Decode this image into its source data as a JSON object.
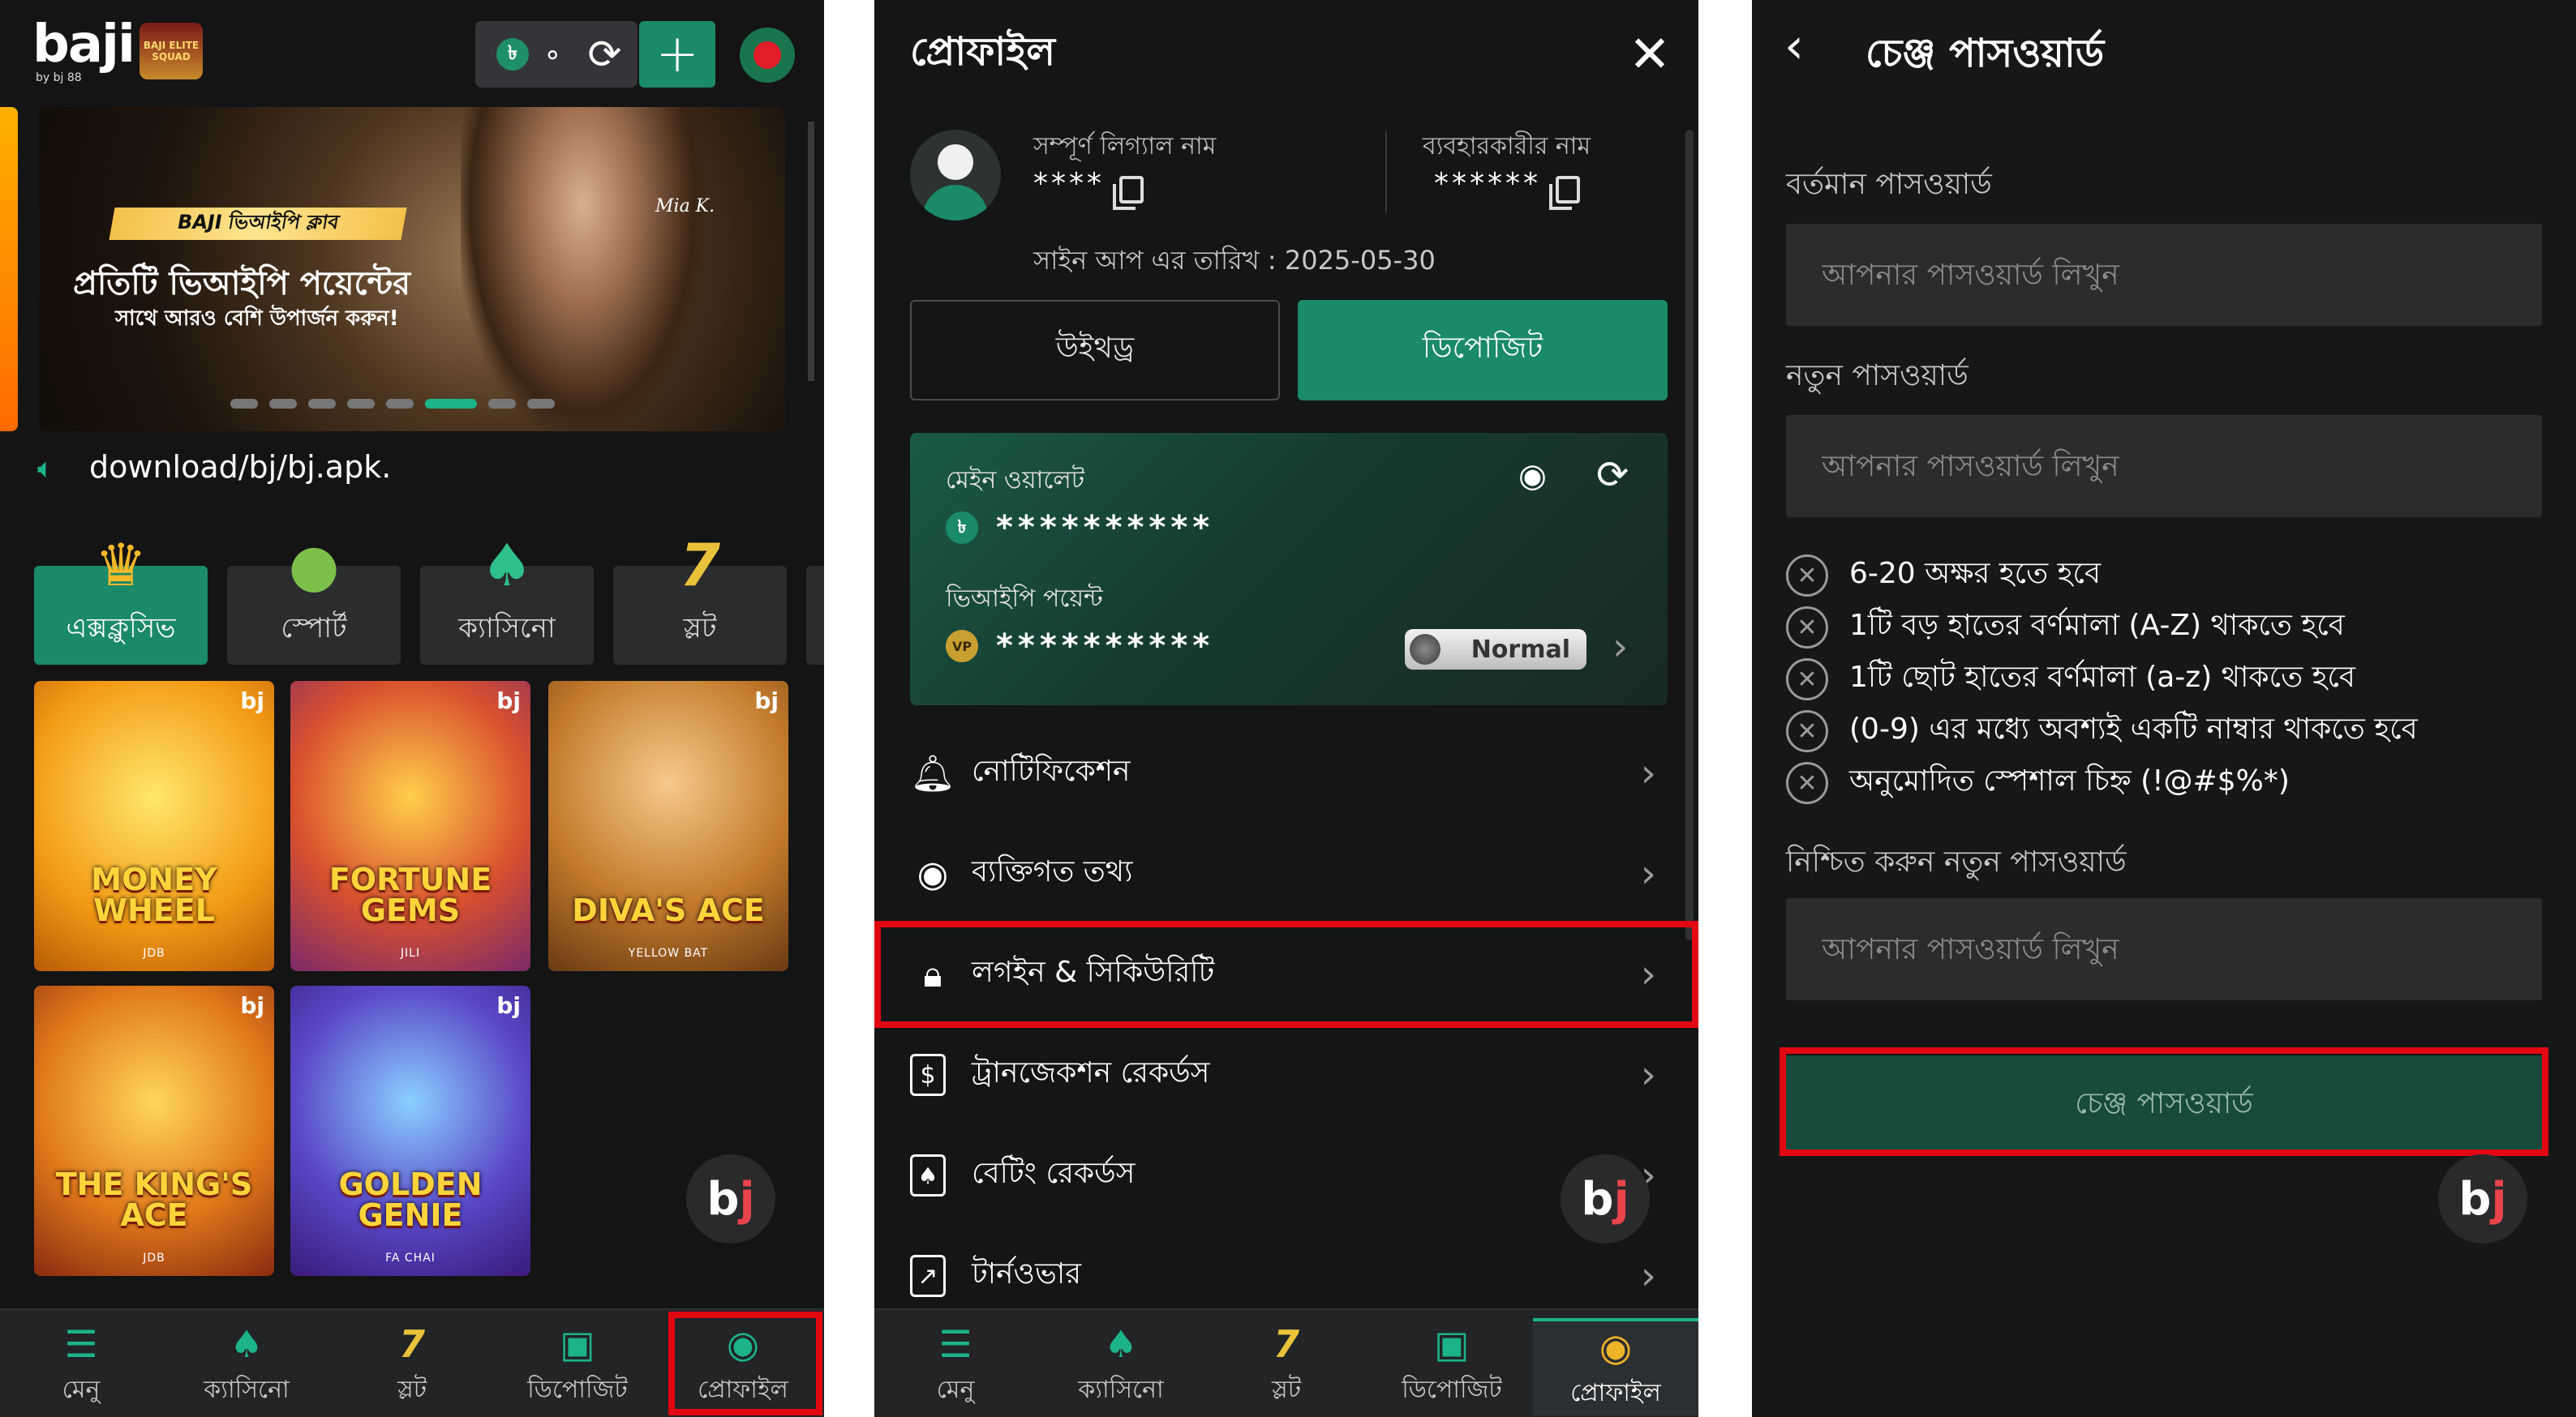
{
  "colors": {
    "accent": "#1a8a68",
    "highlight": "#e30613",
    "background": "#141414"
  },
  "screen1": {
    "logo": "baji",
    "logo_sub": "by bj 88",
    "badge": "BAJI ELITE SQUAD",
    "balance": "∘",
    "currency_icon": "৳",
    "plus": "+",
    "banner": {
      "ribbon": "BAJI ভিআইপি ক্লাব",
      "title": "প্রতিটি ভিআইপি পয়েন্টের",
      "subtitle": "সাথে আরও বেশি উপার্জন করুন!",
      "signature": "Mia K."
    },
    "marquee": "download/bj/bj.apk.",
    "categories": [
      {
        "label": "এক্সক্লুসিভ",
        "icon": "crown-icon",
        "glyph": "♛"
      },
      {
        "label": "স্পোর্ট",
        "icon": "ball-icon",
        "glyph": "●"
      },
      {
        "label": "ক্যাসিনো",
        "icon": "spade-icon",
        "glyph": "♠"
      },
      {
        "label": "স্লট",
        "icon": "seven-icon",
        "glyph": "7"
      }
    ],
    "games": [
      {
        "title": "MONEY WHEEL",
        "provider": "JDB",
        "bj": "bj"
      },
      {
        "title": "FORTUNE GEMS",
        "provider": "JILI",
        "bj": "bj"
      },
      {
        "title": "DIVA'S ACE",
        "provider": "YELLOW BAT",
        "bj": "bj"
      },
      {
        "title": "THE KING'S ACE",
        "provider": "JDB",
        "bj": "bj"
      },
      {
        "title": "GOLDEN GENIE",
        "provider": "FA CHAI",
        "bj": "bj"
      }
    ],
    "fab": {
      "b": "b",
      "j": "j"
    }
  },
  "tabs": [
    {
      "label": "মেনু",
      "icon": "menu-icon",
      "glyph": "☰"
    },
    {
      "label": "ক্যাসিনো",
      "icon": "spade-icon",
      "glyph": "♠"
    },
    {
      "label": "স্লট",
      "icon": "seven-icon",
      "glyph": "7"
    },
    {
      "label": "ডিপোজিট",
      "icon": "deposit-icon",
      "glyph": "▣"
    },
    {
      "label": "প্রোফাইল",
      "icon": "profile-icon",
      "glyph": "◉"
    }
  ],
  "screen2": {
    "title": "প্রোফাইল",
    "close": "✕",
    "full_name_label": "সম্পূর্ণ লিগ্যাল নাম",
    "full_name_value": "****",
    "username_label": "ব্যবহারকারীর নাম",
    "username_value": "******",
    "signup": "সাইন আপ এর তারিখ : 2025-05-30",
    "withdraw": "উইথড্র",
    "deposit": "ডিপোজিট",
    "main_wallet_label": "মেইন ওয়ালেট",
    "main_wallet_value": "**********",
    "vip_label": "ভিআইপি পয়েন্ট",
    "vip_value": "**********",
    "vip_level": "Normal",
    "main_coin": "৳",
    "vip_coin": "VP",
    "menu": [
      {
        "label": "নোটিফিকেশন",
        "icon": "bell-icon",
        "glyph": "🔔︎"
      },
      {
        "label": "ব্যক্তিগত তথ্য",
        "icon": "user-circle-icon",
        "glyph": "◉"
      },
      {
        "label": "লগইন & সিকিউরিটি",
        "icon": "lock-icon",
        "glyph": "🔒︎"
      },
      {
        "label": "ট্রানজেকশন রেকর্ডস",
        "icon": "dollar-file-icon",
        "glyph": "$"
      },
      {
        "label": "বেটিং রেকর্ডস",
        "icon": "bet-file-icon",
        "glyph": "♠"
      },
      {
        "label": "টার্নওভার",
        "icon": "chart-icon",
        "glyph": "↗"
      }
    ],
    "chevron": "›"
  },
  "screen3": {
    "back": "‹",
    "title": "চেঞ্জ পাসওয়ার্ড",
    "current_label": "বর্তমান পাসওয়ার্ড",
    "new_label": "নতুন পাসওয়ার্ড",
    "confirm_label": "নিশ্চিত করুন নতুন পাসওয়ার্ড",
    "placeholder": "আপনার পাসওয়ার্ড লিখুন",
    "rules": [
      "6-20 অক্ষর হতে হবে",
      "1টি বড় হাতের বর্ণমালা (A-Z) থাকতে হবে",
      "1টি ছোট হাতের বর্ণমালা (a-z) থাকতে হবে",
      "(0-9) এর মধ্যে অবশ্যই একটি নাম্বার থাকতে হবে",
      "অনুমোদিত স্পেশাল চিহ্ন (!@#$%*)"
    ],
    "rule_icon": "✕",
    "submit": "চেঞ্জ পাসওয়ার্ড"
  }
}
